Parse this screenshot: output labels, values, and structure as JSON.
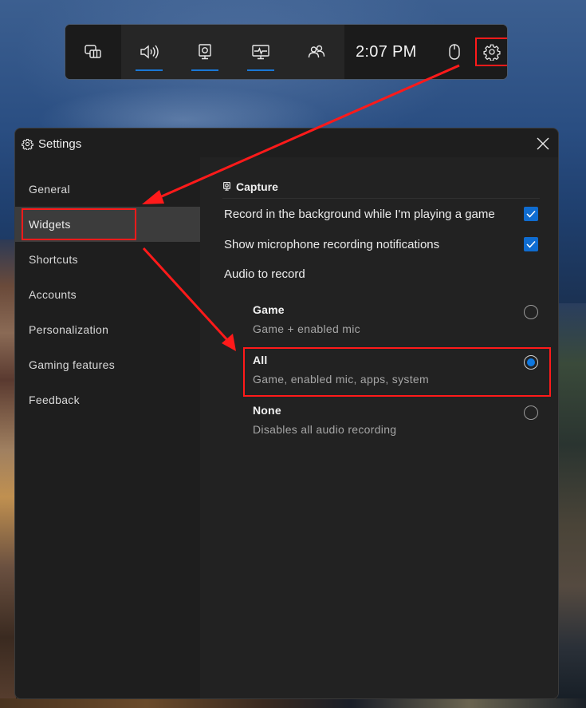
{
  "gamebar": {
    "time": "2:07 PM",
    "buttons": [
      {
        "icon": "widget-menu-icon",
        "active": false
      },
      {
        "icon": "audio-icon",
        "active": true
      },
      {
        "icon": "capture-icon",
        "active": true
      },
      {
        "icon": "performance-icon",
        "active": true
      },
      {
        "icon": "xbox-social-icon",
        "active": false
      }
    ],
    "mouse_icon": "mouse-icon",
    "settings_icon": "gear-icon",
    "accent": "#1a78d6"
  },
  "settings": {
    "title": "Settings",
    "close_icon": "close-icon",
    "nav": [
      {
        "label": "General",
        "active": false
      },
      {
        "label": "Widgets",
        "active": true
      },
      {
        "label": "Shortcuts",
        "active": false
      },
      {
        "label": "Accounts",
        "active": false
      },
      {
        "label": "Personalization",
        "active": false
      },
      {
        "label": "Gaming features",
        "active": false
      },
      {
        "label": "Feedback",
        "active": false
      }
    ],
    "section": {
      "title": "Capture",
      "icon": "capture-icon",
      "options": [
        {
          "label": "Record in the background while I'm playing a game",
          "checked": true
        },
        {
          "label": "Show microphone recording notifications",
          "checked": true
        }
      ],
      "audio_label": "Audio to record",
      "audio_choices": [
        {
          "name": "Game",
          "description": "Game + enabled mic",
          "selected": false
        },
        {
          "name": "All",
          "description": "Game, enabled mic, apps, system",
          "selected": true
        },
        {
          "name": "None",
          "description": "Disables all audio recording",
          "selected": false
        }
      ]
    }
  },
  "annotations": {
    "highlight_color": "#ff1a1a"
  }
}
